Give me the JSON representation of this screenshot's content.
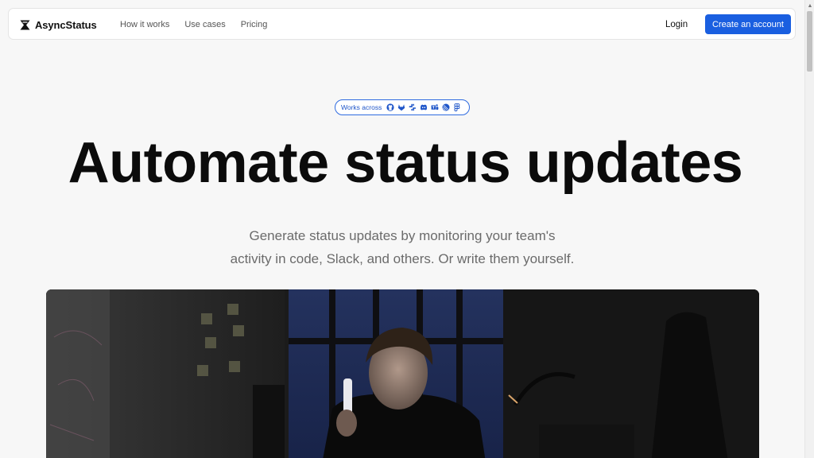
{
  "brand": {
    "name": "AsyncStatus",
    "logo_icon": "hourglass-x-logo-icon"
  },
  "nav": {
    "links": [
      {
        "label": "How it works"
      },
      {
        "label": "Use cases"
      },
      {
        "label": "Pricing"
      }
    ],
    "login_label": "Login",
    "cta_label": "Create an account"
  },
  "badge": {
    "label": "Works across",
    "integrations": [
      "github-icon",
      "gitlab-icon",
      "slack-icon",
      "discord-icon",
      "microsoft-teams-icon",
      "linear-icon",
      "figma-icon"
    ]
  },
  "hero": {
    "title": "Automate status updates",
    "subtitle_line1": "Generate status updates by monitoring your team's",
    "subtitle_line2": "activity in code, Slack, and others. Or write them yourself."
  },
  "colors": {
    "accent": "#1a5fe0",
    "badge_border": "#2f6be0",
    "background": "#f7f7f7",
    "title": "#0b0b0b",
    "subtitle": "#6b6b6b"
  }
}
